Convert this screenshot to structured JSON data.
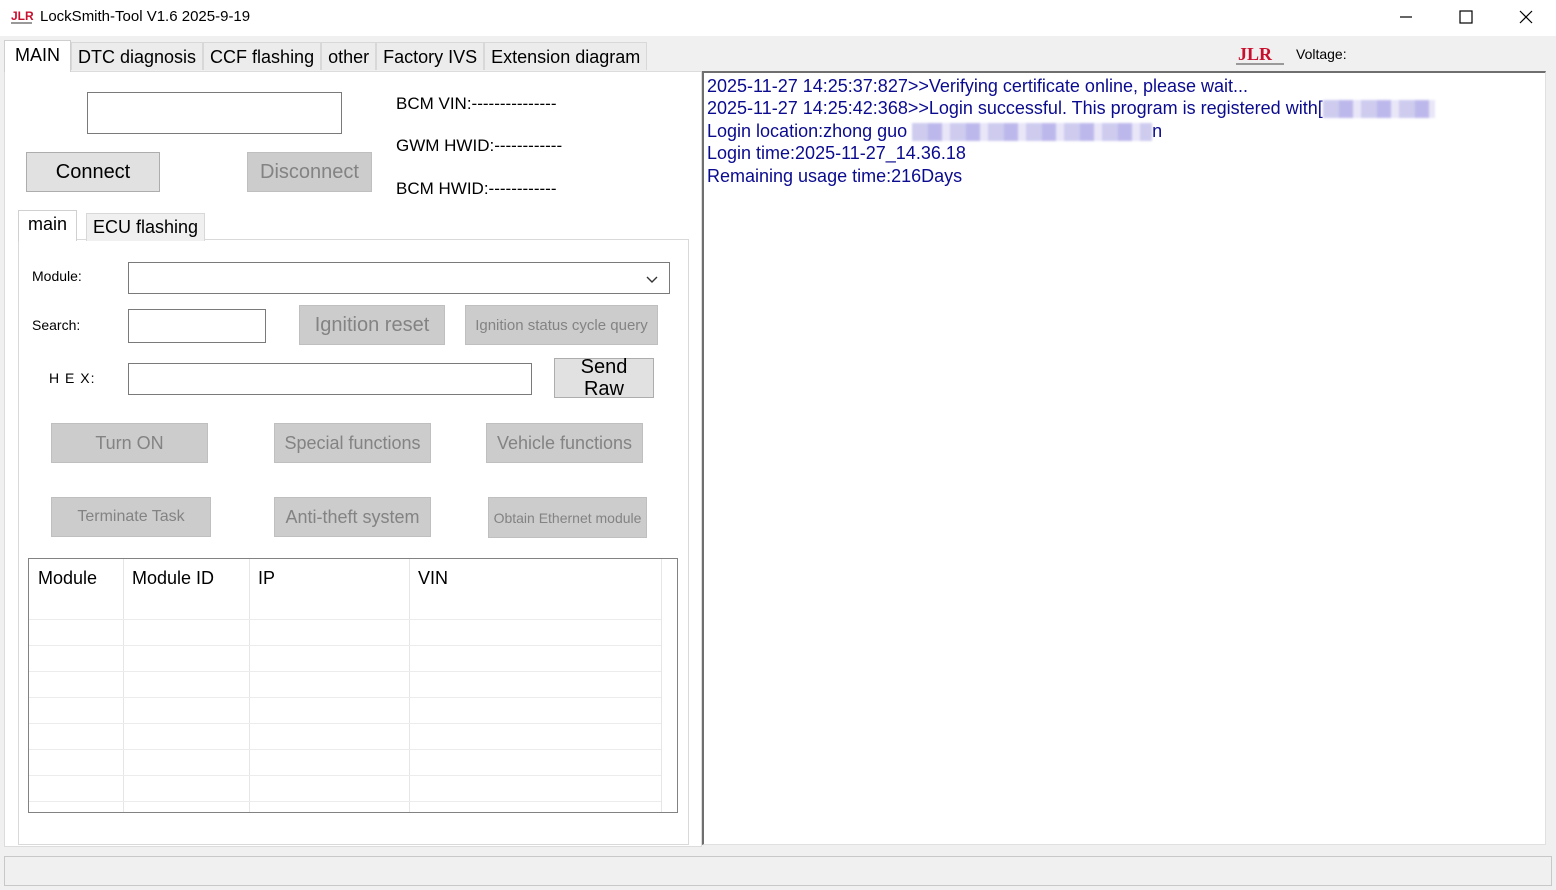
{
  "window": {
    "title": "LockSmith-Tool V1.6 2025-9-19",
    "icon": "jlr-app-icon"
  },
  "top_tabs": [
    {
      "label": "MAIN",
      "active": true
    },
    {
      "label": "DTC diagnosis",
      "active": false
    },
    {
      "label": "CCF flashing",
      "active": false
    },
    {
      "label": "other",
      "active": false
    },
    {
      "label": "Factory IVS",
      "active": false
    },
    {
      "label": "Extension diagram",
      "active": false
    }
  ],
  "header": {
    "logo_text": "JLR",
    "voltage_label": "Voltage:"
  },
  "connection": {
    "vin_input_value": "",
    "connect_label": "Connect",
    "disconnect_label": "Disconnect",
    "bcm_vin": "BCM VIN:---------------",
    "gwm_hwid": "GWM HWID:------------",
    "bcm_hwid": "BCM HWID:------------"
  },
  "inner_tabs": [
    {
      "label": "main",
      "active": true
    },
    {
      "label": "ECU flashing",
      "active": false
    }
  ],
  "form": {
    "module_label": "Module:",
    "module_value": "",
    "search_label": "Search:",
    "search_value": "",
    "hex_label": "H E X:",
    "hex_value": "",
    "ignition_reset": "Ignition reset",
    "ignition_status": "Ignition status cycle query",
    "send_raw_line1": "Send",
    "send_raw_line2": "Raw"
  },
  "actions": {
    "turn_on": "Turn ON",
    "special_functions": "Special functions",
    "vehicle_functions": "Vehicle functions",
    "terminate_task": "Terminate Task",
    "anti_theft": "Anti-theft system",
    "obtain_ethernet": "Obtain Ethernet module"
  },
  "module_table": {
    "columns": [
      "Module",
      "Module ID",
      "IP",
      "VIN"
    ],
    "rows": []
  },
  "log": {
    "line1": "2025-11-27 14:25:37:827>>Verifying certificate online, please wait...",
    "line2": "2025-11-27 14:25:42:368>>Login successful. This program is registered with[",
    "line3_prefix": "Login location:zhong guo ",
    "line3_suffix": "n",
    "line4": "Login time:2025-11-27_14.36.18",
    "line5": "Remaining usage time:216Days",
    "text_color": "#0b0b8f"
  }
}
